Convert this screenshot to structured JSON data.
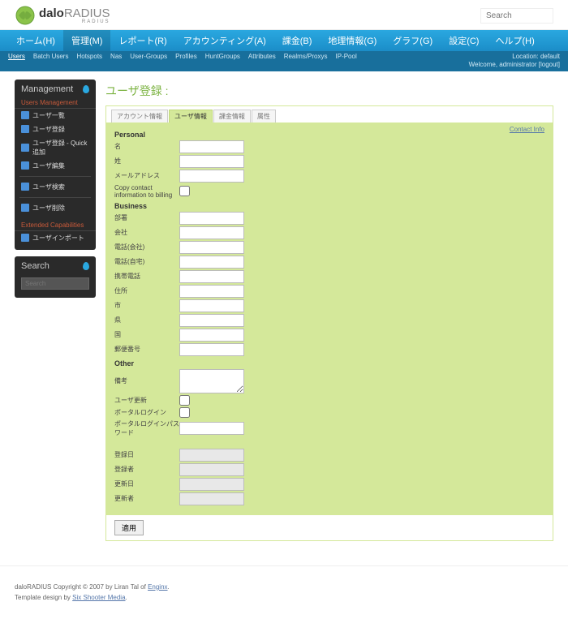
{
  "header": {
    "logo_main": "dalo",
    "logo_sub": "RADIUS",
    "search_placeholder": "Search"
  },
  "nav1": [
    {
      "label": "ホーム(H)"
    },
    {
      "label": "管理(M)",
      "active": true
    },
    {
      "label": "レポート(R)"
    },
    {
      "label": "アカウンティング(A)"
    },
    {
      "label": "課金(B)"
    },
    {
      "label": "地理情報(G)"
    },
    {
      "label": "グラフ(G)"
    },
    {
      "label": "設定(C)"
    },
    {
      "label": "ヘルプ(H)"
    }
  ],
  "nav2_left": [
    "Users",
    "Batch Users",
    "Hotspots",
    "Nas",
    "User-Groups",
    "Profiles",
    "HuntGroups",
    "Attributes",
    "Realms/Proxys",
    "IP-Pool"
  ],
  "nav2_right": {
    "loc_label": "Location:",
    "loc_value": "default",
    "welcome": "Welcome, administrator",
    "logout": "[logout]"
  },
  "sidebar": {
    "mgmt_title": "Management",
    "users_mgmt": "Users Management",
    "items1": [
      "ユーザ一覧",
      "ユーザ登録",
      "ユーザ登録 - Quick追加",
      "ユーザ編集"
    ],
    "items2": [
      "ユーザ検索"
    ],
    "items3": [
      "ユーザ削除"
    ],
    "ext_cap": "Extended Capabilities",
    "items4": [
      "ユーザインポート"
    ],
    "search_title": "Search",
    "search_placeholder": "Search"
  },
  "content": {
    "title": "ユーザ登録 :",
    "tabs": [
      "アカウント情報",
      "ユーザ情報",
      "課金情報",
      "属性"
    ],
    "active_tab": 1,
    "contact_link": "Contact Info",
    "sections": {
      "personal": {
        "h": "Personal",
        "fields": [
          {
            "label": "名",
            "type": "text"
          },
          {
            "label": "姓",
            "type": "text"
          },
          {
            "label": "メールアドレス",
            "type": "text"
          },
          {
            "label": "Copy contact information to billing",
            "type": "checkbox"
          }
        ]
      },
      "business": {
        "h": "Business",
        "fields": [
          {
            "label": "部署",
            "type": "text"
          },
          {
            "label": "会社",
            "type": "text"
          },
          {
            "label": "電話(会社)",
            "type": "text"
          },
          {
            "label": "電話(自宅)",
            "type": "text"
          },
          {
            "label": "携帯電話",
            "type": "text"
          },
          {
            "label": "住所",
            "type": "text"
          },
          {
            "label": "市",
            "type": "text"
          },
          {
            "label": "県",
            "type": "text"
          },
          {
            "label": "国",
            "type": "text"
          },
          {
            "label": "郵便番号",
            "type": "text"
          }
        ]
      },
      "other": {
        "h": "Other",
        "fields": [
          {
            "label": "備考",
            "type": "textarea"
          },
          {
            "label": "ユーザ更新",
            "type": "checkbox"
          },
          {
            "label": "ポータルログイン",
            "type": "checkbox"
          },
          {
            "label": "ポータルログインパスワード",
            "type": "text"
          }
        ]
      },
      "meta": {
        "fields": [
          {
            "label": "登録日",
            "type": "text",
            "ro": true
          },
          {
            "label": "登録者",
            "type": "text",
            "ro": true
          },
          {
            "label": "更新日",
            "type": "text",
            "ro": true
          },
          {
            "label": "更新者",
            "type": "text",
            "ro": true
          }
        ]
      }
    },
    "submit": "適用"
  },
  "footer": {
    "line1_a": "daloRADIUS Copyright © 2007 by Liran Tal of ",
    "line1_link": "Enginx",
    "line2_a": "Template design by ",
    "line2_link": "Six Shooter Media"
  }
}
